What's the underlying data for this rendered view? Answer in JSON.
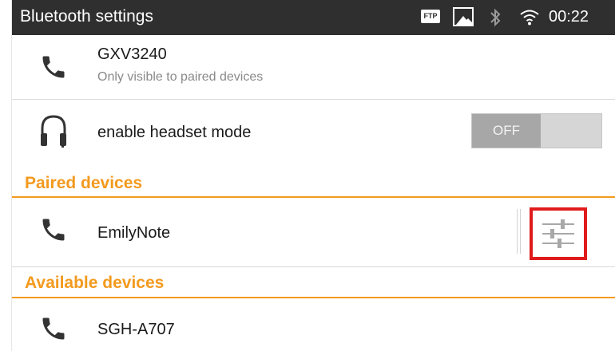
{
  "statusbar": {
    "title": "Bluetooth settings",
    "ftp_label": "FTP",
    "time": "00:22",
    "icons": [
      "ftp-icon",
      "image-icon",
      "bluetooth-icon",
      "wifi-icon"
    ]
  },
  "device": {
    "name": "GXV3240",
    "visibility": "Only visible to paired devices",
    "icon": "phone-icon"
  },
  "headset": {
    "label": "enable headset mode",
    "toggle_label": "OFF",
    "icon": "headset-icon"
  },
  "paired": {
    "header": "Paired devices",
    "items": [
      {
        "name": "EmilyNote",
        "icon": "phone-icon",
        "action_icon": "settings-sliders-icon"
      }
    ]
  },
  "available": {
    "header": "Available devices",
    "items": [
      {
        "name": "SGH-A707",
        "icon": "phone-icon"
      }
    ]
  },
  "colors": {
    "accent": "#f39a1e",
    "statusbar": "#2f2f2f",
    "highlight": "#e01b1b"
  }
}
